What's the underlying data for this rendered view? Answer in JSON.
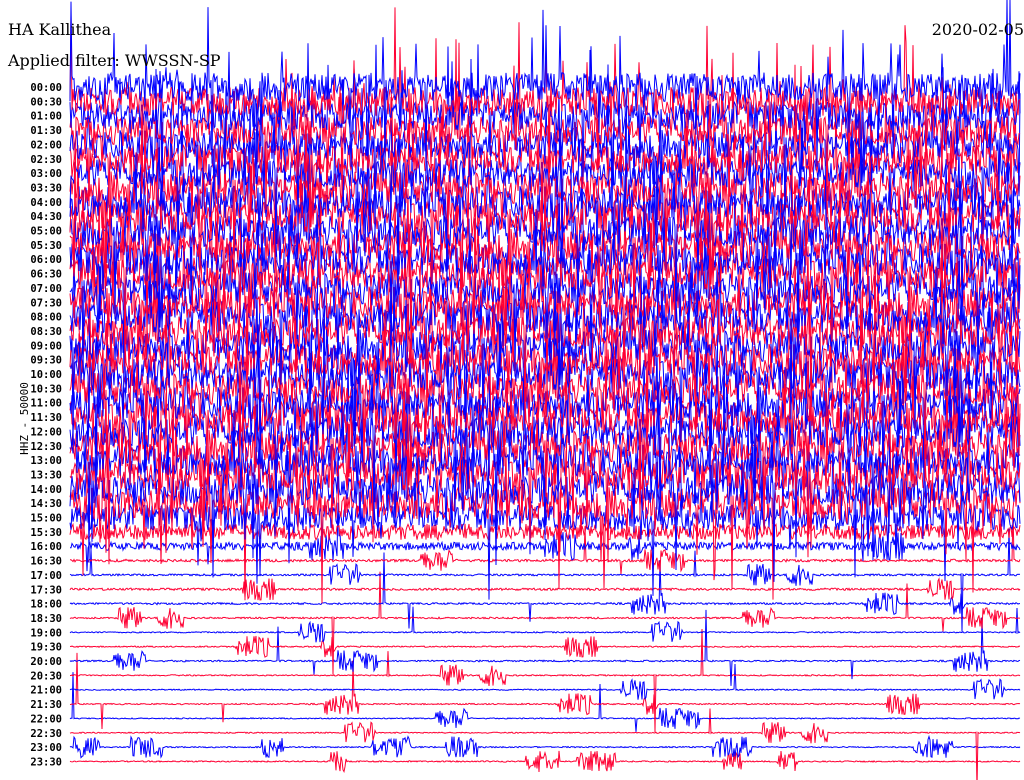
{
  "header": {
    "station": "HA Kallithea",
    "filter": "Applied filter: WWSSN-SP",
    "date": "2020-02-05"
  },
  "chart_data": {
    "type": "line",
    "title": "HA Kallithea",
    "ylabel": "HHZ - 50000",
    "colors": [
      "#0000ff",
      "#ff0033"
    ],
    "row_labels": [
      "00:00",
      "00:30",
      "01:00",
      "01:30",
      "02:00",
      "02:30",
      "03:00",
      "03:30",
      "04:00",
      "04:30",
      "05:00",
      "05:30",
      "06:00",
      "06:30",
      "07:00",
      "07:30",
      "08:00",
      "08:30",
      "09:00",
      "09:30",
      "10:00",
      "10:30",
      "11:00",
      "11:30",
      "12:00",
      "12:30",
      "13:00",
      "13:30",
      "14:00",
      "14:30",
      "15:00",
      "15:30",
      "16:00",
      "16:30",
      "17:00",
      "17:30",
      "18:00",
      "18:30",
      "19:00",
      "19:30",
      "20:00",
      "20:30",
      "21:00",
      "21:30",
      "22:00",
      "22:30",
      "23:00",
      "23:30"
    ],
    "relative_amplitude": [
      9,
      9,
      9,
      9,
      9,
      9,
      9,
      10,
      10,
      10,
      10,
      10,
      10,
      10,
      10,
      10,
      10,
      10,
      10,
      10,
      10,
      10,
      10,
      10,
      10,
      10,
      10,
      10,
      10,
      10,
      8,
      5,
      2.5,
      0.8,
      0.6,
      0.7,
      0.6,
      0.5,
      0.4,
      0.4,
      0.5,
      0.4,
      0.4,
      0.4,
      0.35,
      0.35,
      0.4,
      0.4
    ]
  }
}
